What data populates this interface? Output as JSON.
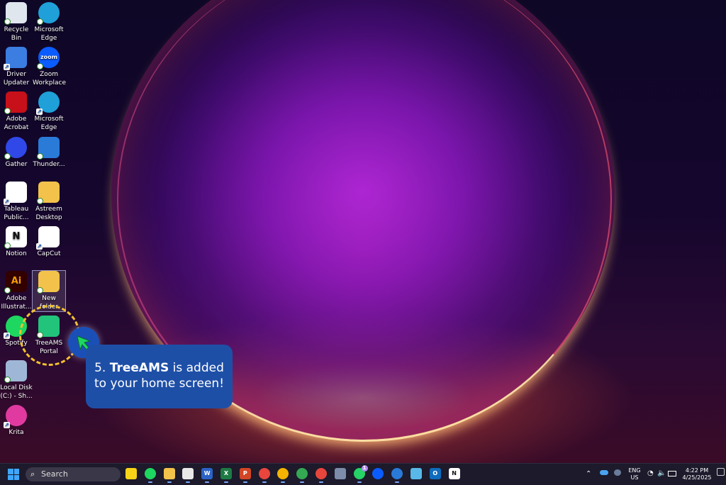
{
  "desktop_icons": [
    {
      "label": "Recycle Bin",
      "icon": "recycle-bin-icon",
      "color": "#dfe6ee"
    },
    {
      "label": "Microsoft\nEdge",
      "icon": "edge-icon",
      "color": "#1fa0d8"
    },
    {
      "label": "Driver\nUpdater",
      "icon": "driver-updater-icon",
      "color": "#3b7de0"
    },
    {
      "label": "Zoom\nWorkplace",
      "icon": "zoom-icon",
      "color": "#0b5cff",
      "glyph": "zoom"
    },
    {
      "label": "Adobe\nAcrobat",
      "icon": "acrobat-icon",
      "color": "#c8101a"
    },
    {
      "label": "Microsoft\nEdge",
      "icon": "edge-icon",
      "color": "#1fa0d8"
    },
    {
      "label": "Gather",
      "icon": "gather-icon",
      "color": "#3048e8"
    },
    {
      "label": "Thunder...",
      "icon": "thunderbird-icon",
      "color": "#2a7ad8"
    },
    {
      "label": "Tableau\nPublic...",
      "icon": "tableau-icon",
      "color": "#ffffff"
    },
    {
      "label": "Astreem\nDesktop",
      "icon": "folder-icon",
      "color": "#f2c24a"
    },
    {
      "label": "Notion",
      "icon": "notion-icon",
      "color": "#ffffff",
      "glyph": "N"
    },
    {
      "label": "CapCut",
      "icon": "capcut-icon",
      "color": "#ffffff"
    },
    {
      "label": "Adobe\nIllustrat...",
      "icon": "illustrator-icon",
      "color": "#330000",
      "glyph": "Ai"
    },
    {
      "label": "New folder",
      "icon": "folder-icon",
      "color": "#f2c24a"
    },
    {
      "label": "Spotify",
      "icon": "spotify-icon",
      "color": "#1ed760"
    },
    {
      "label": "TreeAMS\nPortal",
      "icon": "treeams-icon",
      "color": "#22c37a"
    },
    {
      "label": "Local Disk\n(C:) - Sh...",
      "icon": "local-disk-icon",
      "color": "#9fb7d6"
    },
    {
      "label": "Krita",
      "icon": "krita-icon",
      "color": "#e03aa0"
    }
  ],
  "callout": {
    "step": "5.",
    "app_name": "TreeAMS",
    "line1_rest": "is added",
    "line2": "to your home screen!"
  },
  "taskbar": {
    "search_placeholder": "Search",
    "apps": [
      {
        "name": "sticky-notes-icon",
        "color": "#f7d417"
      },
      {
        "name": "spotify-icon",
        "color": "#1ed760"
      },
      {
        "name": "file-explorer-icon",
        "color": "#f2c24a"
      },
      {
        "name": "snipping-tool-icon",
        "color": "#e8e8e8"
      },
      {
        "name": "word-icon",
        "color": "#2b63c6",
        "glyph": "W"
      },
      {
        "name": "excel-icon",
        "color": "#1e7a44",
        "glyph": "X"
      },
      {
        "name": "powerpoint-icon",
        "color": "#d24625",
        "glyph": "P"
      },
      {
        "name": "chrome-icon",
        "color": "#e8453c"
      },
      {
        "name": "chrome-icon",
        "color": "#f4b400"
      },
      {
        "name": "chrome-icon",
        "color": "#34a853"
      },
      {
        "name": "chrome-icon",
        "color": "#e8453c"
      },
      {
        "name": "calculator-icon",
        "color": "#7d8ca8"
      },
      {
        "name": "whatsapp-icon",
        "color": "#25d366",
        "badge": "1"
      },
      {
        "name": "zoom-icon",
        "color": "#0b5cff"
      },
      {
        "name": "edge-icon",
        "color": "#2a7ad8"
      },
      {
        "name": "notepad-icon",
        "color": "#58b8e8"
      },
      {
        "name": "outlook-icon",
        "color": "#0f6cbd",
        "glyph": "O"
      },
      {
        "name": "notion-icon",
        "color": "#ffffff",
        "glyph": "N"
      }
    ],
    "lang": "ENG",
    "region": "US",
    "time": "4:22 PM",
    "date": "4/25/2025"
  }
}
